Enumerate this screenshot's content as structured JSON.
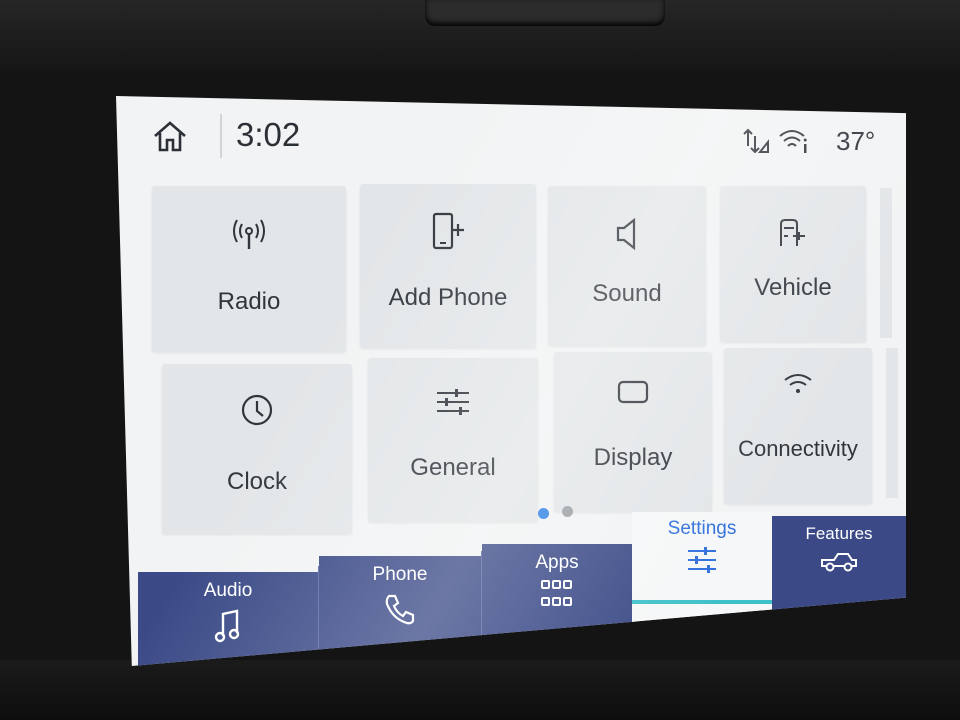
{
  "status_bar": {
    "time": "3:02",
    "temperature": "37°"
  },
  "tiles": [
    {
      "label": "Radio",
      "icon": "radio-antenna-icon"
    },
    {
      "label": "Add Phone",
      "icon": "add-phone-icon"
    },
    {
      "label": "Sound",
      "icon": "speaker-icon"
    },
    {
      "label": "Vehicle",
      "icon": "vehicle-settings-icon"
    },
    {
      "label": "Clock",
      "icon": "clock-icon"
    },
    {
      "label": "General",
      "icon": "sliders-icon"
    },
    {
      "label": "Display",
      "icon": "display-icon"
    },
    {
      "label": "Connectivity",
      "icon": "wifi-icon"
    }
  ],
  "pagination": {
    "current_page": 1,
    "total_pages": 2
  },
  "bottom_nav": {
    "audio": "Audio",
    "phone": "Phone",
    "apps": "Apps",
    "settings": "Settings",
    "features": "Features",
    "active": "Settings"
  },
  "colors": {
    "nav_background": "#3b4a87",
    "active_text": "#2f6fdc",
    "active_indicator": "#3fc1c9",
    "dot_active": "#2f80e4",
    "dot_inactive": "#9aa0a6"
  }
}
